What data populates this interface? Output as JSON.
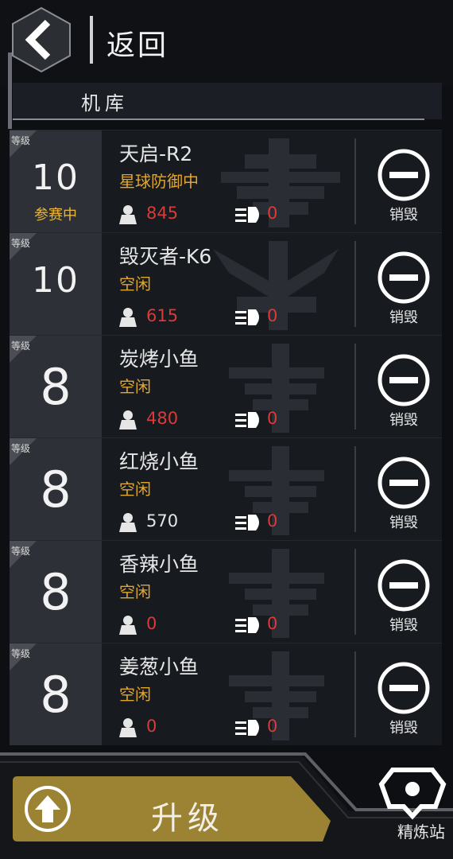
{
  "header": {
    "back_label": "返回"
  },
  "section": {
    "title": "机库"
  },
  "level_tag": "等级",
  "destroy_label": "销毁",
  "rows": [
    {
      "level": "10",
      "level_status": "参赛中",
      "name": "天启-R2",
      "status": "星球防御中",
      "power": "845",
      "engine": "0"
    },
    {
      "level": "10",
      "level_status": "",
      "name": "毁灭者-K6",
      "status": "空闲",
      "power": "615",
      "engine": "0"
    },
    {
      "level": "8",
      "level_status": "",
      "name": "炭烤小鱼",
      "status": "空闲",
      "power": "480",
      "engine": "0"
    },
    {
      "level": "8",
      "level_status": "",
      "name": "红烧小鱼",
      "status": "空闲",
      "power": "570",
      "engine": "0"
    },
    {
      "level": "8",
      "level_status": "",
      "name": "香辣小鱼",
      "status": "空闲",
      "power": "0",
      "engine": "0"
    },
    {
      "level": "8",
      "level_status": "",
      "name": "姜葱小鱼",
      "status": "空闲",
      "power": "0",
      "engine": "0"
    }
  ],
  "footer": {
    "upgrade_label": "升级",
    "refinery_label": "精炼站"
  },
  "colors": {
    "accent_gold": "#9c8334",
    "status_orange": "#e2a72e",
    "power_red": "#d93b3b"
  }
}
